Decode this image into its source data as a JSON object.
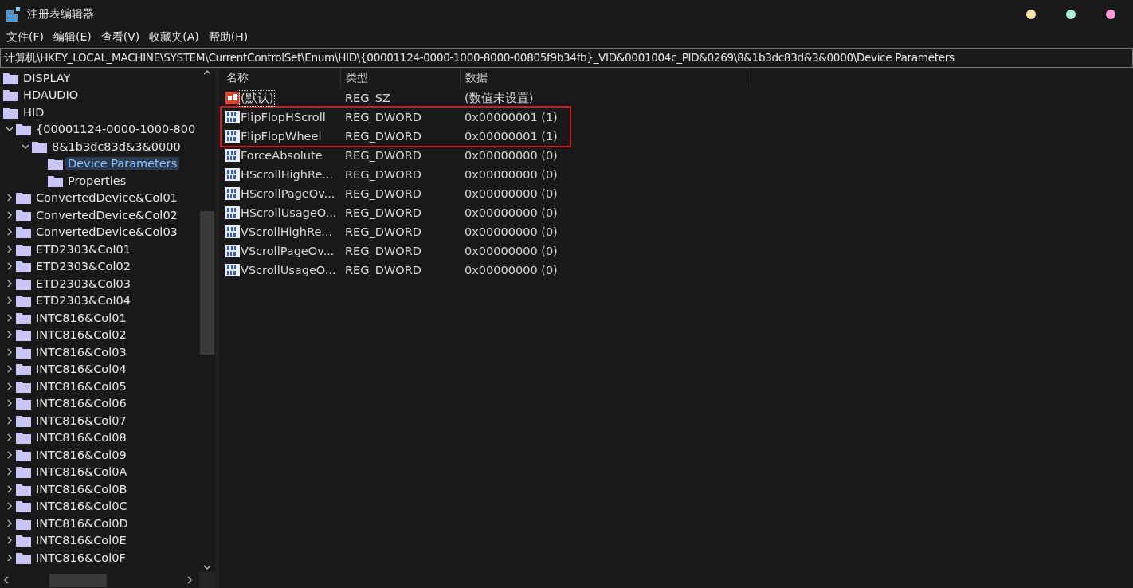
{
  "window": {
    "title": "注册表编辑器",
    "controls": [
      {
        "color": "#fbe3a6"
      },
      {
        "color": "#a6f0d2"
      },
      {
        "color": "#f79bd9"
      }
    ]
  },
  "menu": [
    {
      "label": "文件(F)"
    },
    {
      "label": "编辑(E)"
    },
    {
      "label": "查看(V)"
    },
    {
      "label": "收藏夹(A)"
    },
    {
      "label": "帮助(H)"
    }
  ],
  "address": {
    "value": "计算机\\HKEY_LOCAL_MACHINE\\SYSTEM\\CurrentControlSet\\Enum\\HID\\{00001124-0000-1000-8000-00805f9b34fb}_VID&0001004c_PID&0269\\8&1b3dc83d&3&0000\\Device Parameters"
  },
  "tree": [
    {
      "label": "DISPLAY",
      "selected": false
    },
    {
      "label": "HDAUDIO",
      "selected": false
    },
    {
      "label": "HID",
      "selected": false,
      "children": [
        {
          "label": "{00001124-0000-1000-800",
          "selected": false,
          "expanded": true,
          "children": [
            {
              "label": "8&1b3dc83d&3&0000",
              "selected": false,
              "expanded": true,
              "children": [
                {
                  "label": "Device Parameters",
                  "selected": true
                },
                {
                  "label": "Properties",
                  "selected": false
                }
              ]
            }
          ]
        },
        {
          "label": "ConvertedDevice&Col01",
          "selected": false,
          "expanded": false
        },
        {
          "label": "ConvertedDevice&Col02",
          "selected": false,
          "expanded": false
        },
        {
          "label": "ConvertedDevice&Col03",
          "selected": false,
          "expanded": false
        },
        {
          "label": "ETD2303&Col01",
          "selected": false,
          "expanded": false
        },
        {
          "label": "ETD2303&Col02",
          "selected": false,
          "expanded": false
        },
        {
          "label": "ETD2303&Col03",
          "selected": false,
          "expanded": false
        },
        {
          "label": "ETD2303&Col04",
          "selected": false,
          "expanded": false
        },
        {
          "label": "INTC816&Col01",
          "selected": false,
          "expanded": false
        },
        {
          "label": "INTC816&Col02",
          "selected": false,
          "expanded": false
        },
        {
          "label": "INTC816&Col03",
          "selected": false,
          "expanded": false
        },
        {
          "label": "INTC816&Col04",
          "selected": false,
          "expanded": false
        },
        {
          "label": "INTC816&Col05",
          "selected": false,
          "expanded": false
        },
        {
          "label": "INTC816&Col06",
          "selected": false,
          "expanded": false
        },
        {
          "label": "INTC816&Col07",
          "selected": false,
          "expanded": false
        },
        {
          "label": "INTC816&Col08",
          "selected": false,
          "expanded": false
        },
        {
          "label": "INTC816&Col09",
          "selected": false,
          "expanded": false
        },
        {
          "label": "INTC816&Col0A",
          "selected": false,
          "expanded": false
        },
        {
          "label": "INTC816&Col0B",
          "selected": false,
          "expanded": false
        },
        {
          "label": "INTC816&Col0C",
          "selected": false,
          "expanded": false
        },
        {
          "label": "INTC816&Col0D",
          "selected": false,
          "expanded": false
        },
        {
          "label": "INTC816&Col0E",
          "selected": false,
          "expanded": false
        },
        {
          "label": "INTC816&Col0F",
          "selected": false,
          "expanded": false
        }
      ]
    }
  ],
  "values": {
    "columns": [
      "名称",
      "类型",
      "数据"
    ],
    "rows": [
      {
        "kind": "string",
        "name": "(默认)",
        "type": "REG_SZ",
        "data": "(数值未设置)",
        "focused": true,
        "boxed": false
      },
      {
        "kind": "dword",
        "name": "FlipFlopHScroll",
        "type": "REG_DWORD",
        "data": "0x00000001 (1)",
        "focused": false,
        "boxed": true
      },
      {
        "kind": "dword",
        "name": "FlipFlopWheel",
        "type": "REG_DWORD",
        "data": "0x00000001 (1)",
        "focused": false,
        "boxed": true
      },
      {
        "kind": "dword",
        "name": "ForceAbsolute",
        "type": "REG_DWORD",
        "data": "0x00000000 (0)",
        "focused": false,
        "boxed": false
      },
      {
        "kind": "dword",
        "name": "HScrollHighRe...",
        "type": "REG_DWORD",
        "data": "0x00000000 (0)",
        "focused": false,
        "boxed": false
      },
      {
        "kind": "dword",
        "name": "HScrollPageOv...",
        "type": "REG_DWORD",
        "data": "0x00000000 (0)",
        "focused": false,
        "boxed": false
      },
      {
        "kind": "dword",
        "name": "HScrollUsageO...",
        "type": "REG_DWORD",
        "data": "0x00000000 (0)",
        "focused": false,
        "boxed": false
      },
      {
        "kind": "dword",
        "name": "VScrollHighRe...",
        "type": "REG_DWORD",
        "data": "0x00000000 (0)",
        "focused": false,
        "boxed": false
      },
      {
        "kind": "dword",
        "name": "VScrollPageOv...",
        "type": "REG_DWORD",
        "data": "0x00000000 (0)",
        "focused": false,
        "boxed": false
      },
      {
        "kind": "dword",
        "name": "VScrollUsageO...",
        "type": "REG_DWORD",
        "data": "0x00000000 (0)",
        "focused": false,
        "boxed": false
      }
    ]
  }
}
